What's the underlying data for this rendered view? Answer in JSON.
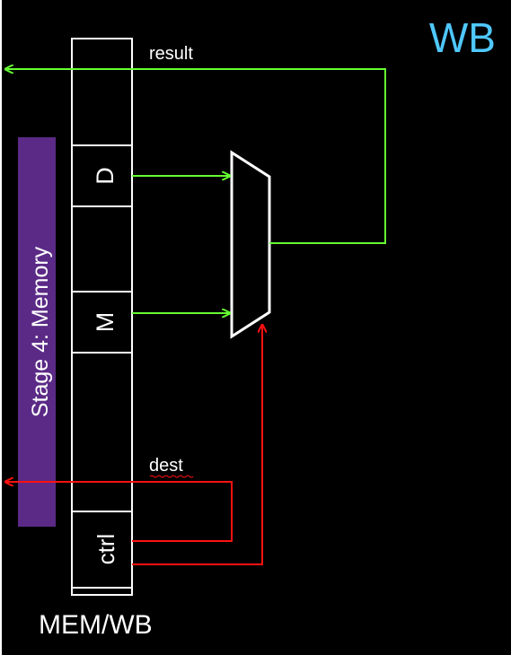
{
  "stage_title": "WB",
  "stage_banner": "Stage 4: Memory",
  "register_name": "MEM/WB",
  "register_fields": {
    "d": "D",
    "m": "M",
    "ctrl": "ctrl"
  },
  "signals": {
    "result": "result",
    "dest": "dest"
  },
  "colors": {
    "background": "#000000",
    "title": "#4fc8ff",
    "banner": "#5b2a86",
    "data_path": "#66ff33",
    "control_path": "#ff1111",
    "outline": "#ffffff"
  }
}
